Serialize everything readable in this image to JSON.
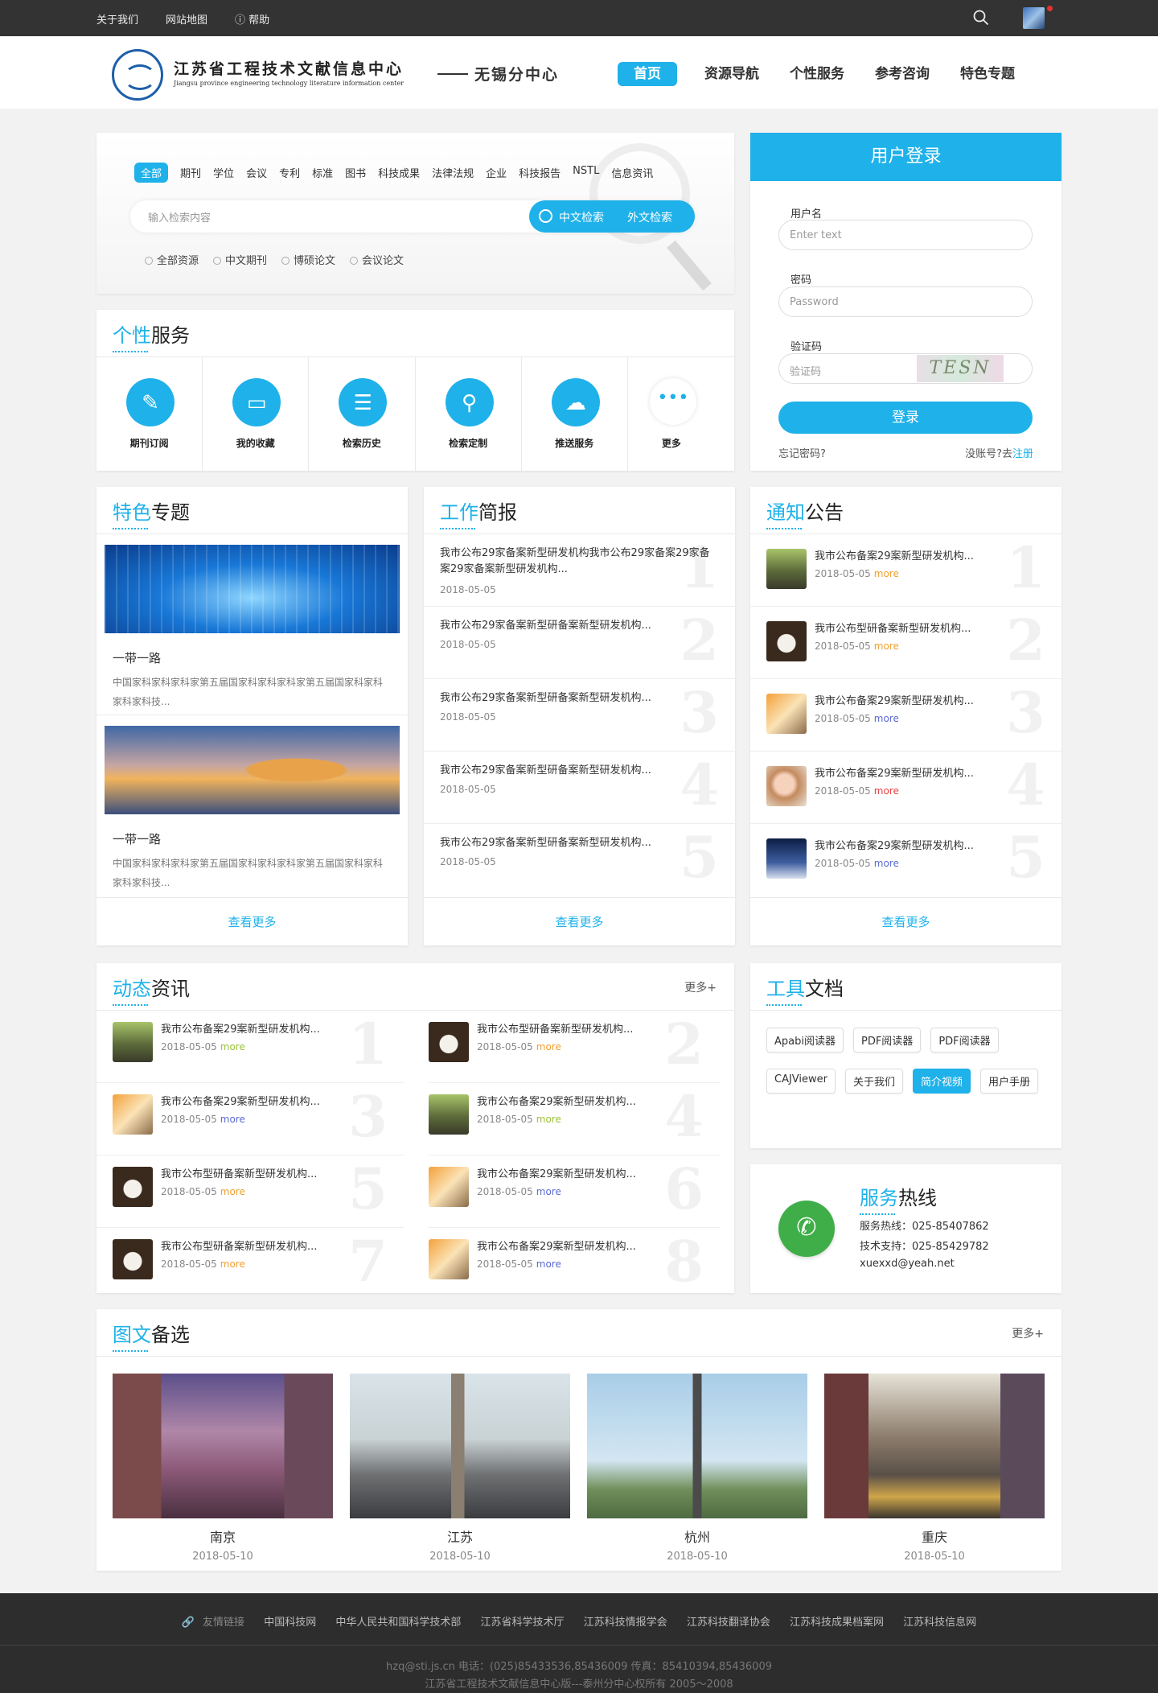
{
  "topbar": {
    "links": [
      "关于我们",
      "网站地图",
      "帮助"
    ]
  },
  "header": {
    "title": "江苏省工程技术文献信息中心",
    "subtitle": "Jiangsu province engineering technology literature information center",
    "branch": "无锡分中心",
    "nav": [
      "首页",
      "资源导航",
      "个性服务",
      "参考咨询",
      "特色专题"
    ]
  },
  "search": {
    "tabs": [
      "全部",
      "期刊",
      "学位",
      "会议",
      "专利",
      "标准",
      "图书",
      "科技成果",
      "法律法规",
      "企业",
      "科技报告",
      "NSTL",
      "信息资讯"
    ],
    "placeholder": "输入检索内容",
    "btn_cn": "中文检索",
    "btn_foreign": "外文检索",
    "radios": [
      "全部资源",
      "中文期刊",
      "博硕论文",
      "会议论文"
    ]
  },
  "services": {
    "title_a": "个性",
    "title_b": "服务",
    "items": [
      "期刊订阅",
      "我的收藏",
      "检索历史",
      "检索定制",
      "推送服务",
      "更多"
    ]
  },
  "login": {
    "title": "用户登录",
    "username_label": "用户名",
    "username_ph": "Enter text",
    "password_label": "密码",
    "password_ph": "Password",
    "captcha_label": "验证码",
    "captcha_ph": "验证码",
    "captcha_text": "TESN",
    "submit": "登录",
    "forgot": "忘记密码?",
    "no_account": "没账号?去",
    "register": "注册"
  },
  "featured": {
    "title_a": "特色",
    "title_b": "专题",
    "items": [
      {
        "title": "一带一路",
        "desc": "中国家科家科家科家第五届国家科家科家科家第五届国家科家科家科家科技..."
      },
      {
        "title": "一带一路",
        "desc": "中国家科家科家科家第五届国家科家科家科家第五届国家科家科家科家科技..."
      }
    ],
    "more": "查看更多"
  },
  "briefs": {
    "title_a": "工作",
    "title_b": "简报",
    "items": [
      {
        "title": "我市公布29家备案新型研发机构我市公布29家备案29家备案29家备案新型研发机构...",
        "date": "2018-05-05",
        "num": "1"
      },
      {
        "title": "我市公布29家备案新型研备案新型研发机构...",
        "date": "2018-05-05",
        "num": "2"
      },
      {
        "title": "我市公布29家备案新型研备案新型研发机构...",
        "date": "2018-05-05",
        "num": "3"
      },
      {
        "title": "我市公布29家备案新型研备案新型研发机构...",
        "date": "2018-05-05",
        "num": "4"
      },
      {
        "title": "我市公布29家备案新型研备案新型研发机构...",
        "date": "2018-05-05",
        "num": "5"
      }
    ],
    "more": "查看更多"
  },
  "notices": {
    "title_a": "通知",
    "title_b": "公告",
    "items": [
      {
        "title": "我市公布备案29案新型研发机构...",
        "date": "2018-05-05",
        "more": "more",
        "more_color": "#f0a030",
        "num": "1"
      },
      {
        "title": "我市公布型研备案新型研发机构...",
        "date": "2018-05-05",
        "more": "more",
        "more_color": "#f0a030",
        "num": "2"
      },
      {
        "title": "我市公布备案29案新型研发机构...",
        "date": "2018-05-05",
        "more": "more",
        "more_color": "#5b6bd1",
        "num": "3"
      },
      {
        "title": "我市公布备案29案新型研发机构...",
        "date": "2018-05-05",
        "more": "more",
        "more_color": "#e94040",
        "num": "4"
      },
      {
        "title": "我市公布备案29案新型研发机构...",
        "date": "2018-05-05",
        "more": "more",
        "more_color": "#5b6bd1",
        "num": "5"
      }
    ],
    "more": "查看更多"
  },
  "news": {
    "title_a": "动态",
    "title_b": "资讯",
    "more": "更多+",
    "left": [
      {
        "title": "我市公布备案29案新型研发机构...",
        "date": "2018-05-05",
        "more": "more",
        "more_color": "#9cc13a",
        "num": "1"
      },
      {
        "title": "我市公布备案29案新型研发机构...",
        "date": "2018-05-05",
        "more": "more",
        "more_color": "#5b6bd1",
        "num": "3"
      },
      {
        "title": "我市公布型研备案新型研发机构...",
        "date": "2018-05-05",
        "more": "more",
        "more_color": "#f0a030",
        "num": "5"
      },
      {
        "title": "我市公布型研备案新型研发机构...",
        "date": "2018-05-05",
        "more": "more",
        "more_color": "#f0a030",
        "num": "7"
      }
    ],
    "right": [
      {
        "title": "我市公布型研备案新型研发机构...",
        "date": "2018-05-05",
        "more": "more",
        "more_color": "#f0a030",
        "num": "2"
      },
      {
        "title": "我市公布备案29案新型研发机构...",
        "date": "2018-05-05",
        "more": "more",
        "more_color": "#9cc13a",
        "num": "4"
      },
      {
        "title": "我市公布备案29案新型研发机构...",
        "date": "2018-05-05",
        "more": "more",
        "more_color": "#5b6bd1",
        "num": "6"
      },
      {
        "title": "我市公布备案29案新型研发机构...",
        "date": "2018-05-05",
        "more": "more",
        "more_color": "#5b6bd1",
        "num": "8"
      }
    ]
  },
  "tools": {
    "title_a": "工具",
    "title_b": "文档",
    "tags": [
      "Apabi阅读器",
      "PDF阅读器",
      "PDF阅读器",
      "CAJViewer",
      "关于我们",
      "简介视频",
      "用户手册"
    ]
  },
  "hotline": {
    "title_a": "服务",
    "title_b": "热线",
    "line1": "服务热线：025-85407862",
    "line2": "技术支持：025-85429782",
    "email": "xuexxd@yeah.net"
  },
  "gallery": {
    "title_a": "图文",
    "title_b": "备选",
    "more": "更多+",
    "items": [
      {
        "name": "南京",
        "date": "2018-05-10"
      },
      {
        "name": "江苏",
        "date": "2018-05-10"
      },
      {
        "name": "杭州",
        "date": "2018-05-10"
      },
      {
        "name": "重庆",
        "date": "2018-05-10"
      }
    ]
  },
  "footer": {
    "links_label": "友情链接",
    "links": [
      "中国科技网",
      "中华人民共和国科学技术部",
      "江苏省科学技术厅",
      "江苏科技情报学会",
      "江苏科技翻译协会",
      "江苏科技成果档案网",
      "江苏科技信息网"
    ],
    "contact": "hzq@sti.js.cn 电话：(025)85433536,85436009 传真：85410394,85436009",
    "copyright": "江苏省工程技术文献信息中心版---泰州分中心权所有 2005～2008"
  },
  "colors": {
    "accent": "#1fb1e9",
    "topbar": "#333333",
    "footer": "#2d2d2d"
  }
}
